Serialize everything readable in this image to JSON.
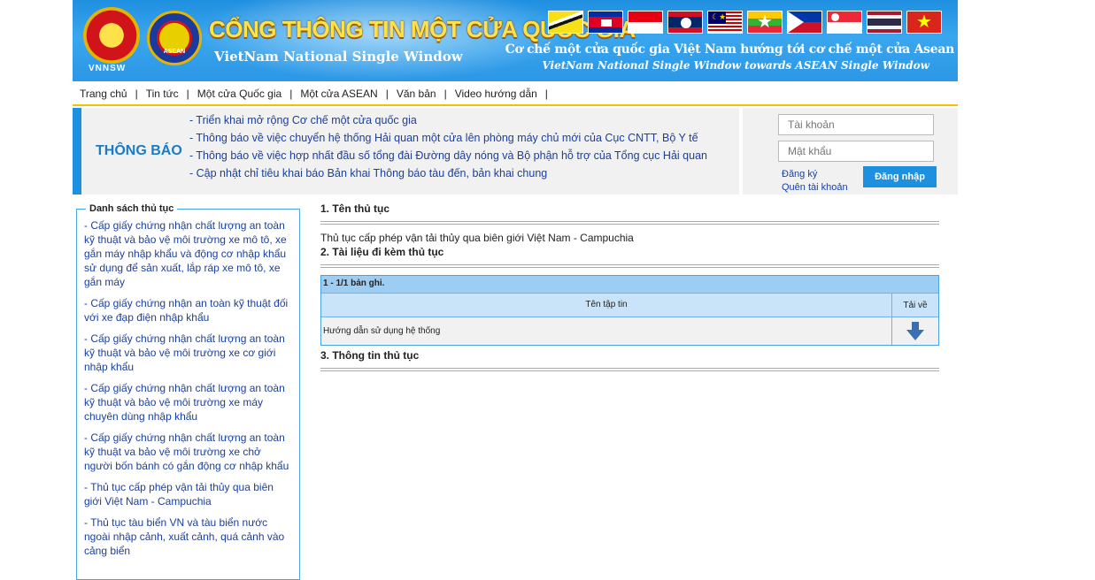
{
  "header": {
    "emblem_label": "VNNSW",
    "asean_label": "ASEAN",
    "title": "CỔNG THÔNG TIN MỘT CỬA QUỐC GIA",
    "subtitle": "VietNam National Single Window",
    "slogan": "Cơ chế một cửa quốc gia Việt Nam hướng tới cơ chế một cửa Asean",
    "slogan_en": "VietNam National Single Window towards ASEAN Single Window",
    "flags": [
      "brunei-flag",
      "cambodia-flag",
      "indonesia-flag",
      "laos-flag",
      "malaysia-flag",
      "myanmar-flag",
      "philippines-flag",
      "singapore-flag",
      "thailand-flag",
      "vietnam-flag"
    ]
  },
  "nav": {
    "items": [
      "Trang chủ",
      "Tin tức",
      "Một cửa Quốc gia",
      "Một cửa ASEAN",
      "Văn bản",
      "Video hướng dẫn"
    ]
  },
  "notice": {
    "label": "THÔNG BÁO",
    "items": [
      "- Triển khai mở rộng Cơ chế một cửa quốc gia",
      "- Thông báo về việc chuyển hệ thống Hải quan một cửa lên phòng máy chủ mới của Cục CNTT, Bộ Y tế",
      "- Thông báo về việc hợp nhất đầu số tổng đài Đường dây nóng và Bộ phận hỗ trợ của Tổng cục Hải quan",
      "- Cập nhật chỉ tiêu khai báo Bản khai Thông báo tàu đến, bản khai chung"
    ]
  },
  "login": {
    "username_placeholder": "Tài khoản",
    "password_placeholder": "Mật khẩu",
    "register_label": "Đăng ký",
    "forgot_label": "Quên tài khoản",
    "login_button": "Đăng nhập"
  },
  "sidebar": {
    "title": "Danh sách thủ tục",
    "items": [
      "- Cấp giấy chứng nhận chất lượng an toàn kỹ thuật và bảo vệ môi trường xe mô tô, xe gắn máy nhập khẩu và động cơ nhập khẩu sử dụng để sản xuất, lắp ráp xe mô tô, xe gắn máy",
      "- Cấp giấy chứng nhận an toàn kỹ thuật đối với xe đạp điện nhập khẩu",
      "- Cấp giấy chứng nhận chất lượng an toàn kỹ thuật và bảo vệ môi trường xe cơ giới nhập khẩu",
      "- Cấp giấy chứng nhận chất lượng an toàn kỹ thuật và bảo vệ môi trường xe máy chuyên dùng nhập khẩu",
      "- Cấp giấy chứng nhận chất lượng an toàn kỹ thuật va bảo vệ môi trường xe chở người bốn bánh có gắn động cơ nhập khẩu",
      "- Thủ tục cấp phép vận tải thủy qua biên giới Việt Nam - Campuchia",
      "- Thủ tục tàu biển VN và tàu biển nước ngoài nhập cảnh, xuất cảnh, quá cảnh vào cảng biển"
    ]
  },
  "main": {
    "section1_title": "1. Tên thủ tục",
    "procedure_name": "Thủ tục cấp phép vận tải thủy qua biên giới Việt Nam - Campuchia",
    "section2_title": "2. Tài liệu đi kèm thủ tục",
    "record_count": "1 - 1/1 bản ghi.",
    "col_filename": "Tên tập tin",
    "col_download": "Tải về",
    "files": [
      {
        "name": "Hướng dẫn sử dụng hệ thống"
      }
    ],
    "section3_title": "3. Thông tin thủ tục"
  },
  "colors": {
    "banner_blue": "#1f8fe0",
    "title_yellow": "#ffe14a",
    "link_blue": "#1a3fa0",
    "accent_blue": "#1e90e0"
  }
}
